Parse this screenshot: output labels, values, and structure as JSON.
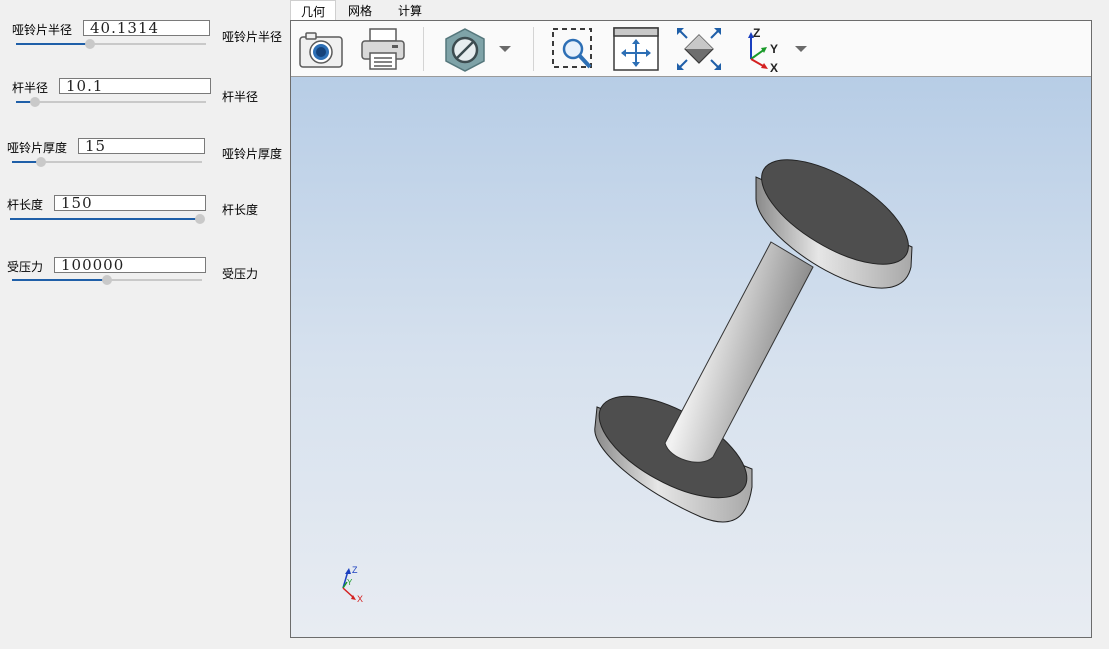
{
  "params": [
    {
      "label": "哑铃片半径",
      "value": "40.1314",
      "side_label": "哑铃片半径",
      "slider_fraction": 0.39
    },
    {
      "label": "杆半径",
      "value": "10.1",
      "side_label": "杆半径",
      "slider_fraction": 0.1
    },
    {
      "label": "哑铃片厚度",
      "value": "15",
      "side_label": "哑铃片厚度",
      "slider_fraction": 0.15
    },
    {
      "label": "杆长度",
      "value": "150",
      "side_label": "杆长度",
      "slider_fraction": 1.0
    },
    {
      "label": "受压力",
      "value": "100000",
      "side_label": "受压力",
      "slider_fraction": 0.5
    }
  ],
  "tabs": [
    {
      "label": "几何",
      "active": true
    },
    {
      "label": "网格",
      "active": false
    },
    {
      "label": "计算",
      "active": false
    }
  ],
  "toolbar": {
    "buttons": [
      {
        "name": "screenshot-camera-icon"
      },
      {
        "name": "print-icon"
      },
      {
        "name": "display-mode-icon"
      },
      {
        "name": "zoom-box-icon"
      },
      {
        "name": "pan-icon"
      },
      {
        "name": "fit-all-icon"
      },
      {
        "name": "axes-view-icon"
      }
    ],
    "axis_labels": {
      "z": "Z",
      "y": "Y",
      "x": "X"
    }
  },
  "scene": {
    "triad_labels": {
      "z": "Z",
      "y": "Y",
      "x": "X"
    }
  },
  "colors": {
    "slider_accent": "#1f5fa8",
    "camera_icon_blue": "#2d6fb5",
    "axis_x": "#d42020",
    "axis_y": "#1a9a2a",
    "axis_z": "#1a3fbf",
    "disc_face": "#4e4e4e"
  }
}
